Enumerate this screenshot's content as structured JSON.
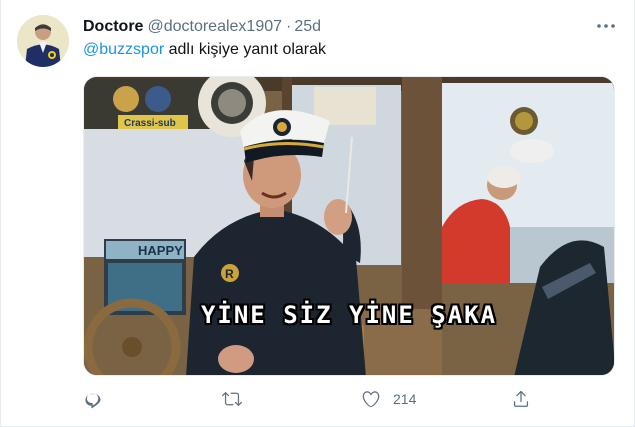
{
  "tweet": {
    "display_name": "Doctore",
    "handle": "@doctorealex1907",
    "separator": "·",
    "time": "25d",
    "reply_mention": "@buzzspor",
    "reply_suffix": " adlı kişiye yanıt olarak",
    "media_caption": "YİNE SİZ YİNE ŞAKA"
  },
  "media_signs": {
    "happy": "HAPPY",
    "crassi": "Crassi-sub",
    "cap_badge": "R"
  },
  "actions": {
    "reply_icon": "reply-icon",
    "retweet_icon": "retweet-icon",
    "like_icon": "heart-icon",
    "like_count": "214",
    "share_icon": "share-icon"
  },
  "colors": {
    "link": "#1b95e0",
    "secondary_text": "#5b7083",
    "primary_text": "#0f1419"
  }
}
